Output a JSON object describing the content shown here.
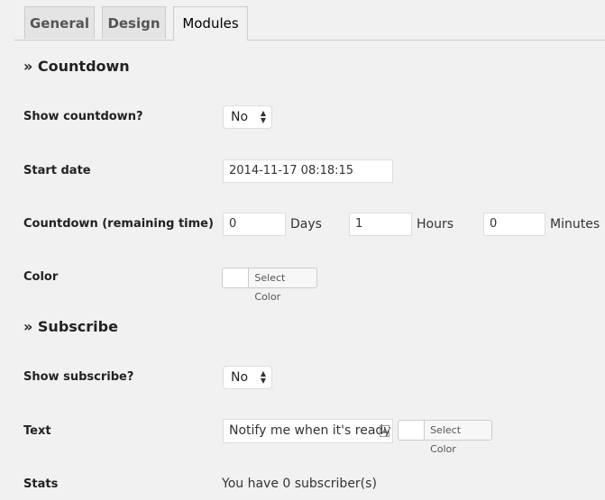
{
  "tabs": [
    {
      "label": "General"
    },
    {
      "label": "Design"
    },
    {
      "label": "Modules",
      "active": true
    }
  ],
  "countdown": {
    "heading": "» Countdown",
    "show_label": "Show countdown?",
    "show_value": "No",
    "start_label": "Start date",
    "start_value": "2014-11-17 08:18:15",
    "remaining_label": "Countdown (remaining time)",
    "days_value": "0",
    "days_unit": "Days",
    "hours_value": "1",
    "hours_unit": "Hours",
    "minutes_value": "0",
    "minutes_unit": "Minutes",
    "color_label": "Color",
    "color_button": "Select Color"
  },
  "subscribe": {
    "heading": "» Subscribe",
    "show_label": "Show subscribe?",
    "show_value": "No",
    "text_label": "Text",
    "text_value": "Notify me when it's ready",
    "color_button": "Select Color",
    "stats_label": "Stats",
    "stats_value": "You have 0 subscriber(s)"
  }
}
